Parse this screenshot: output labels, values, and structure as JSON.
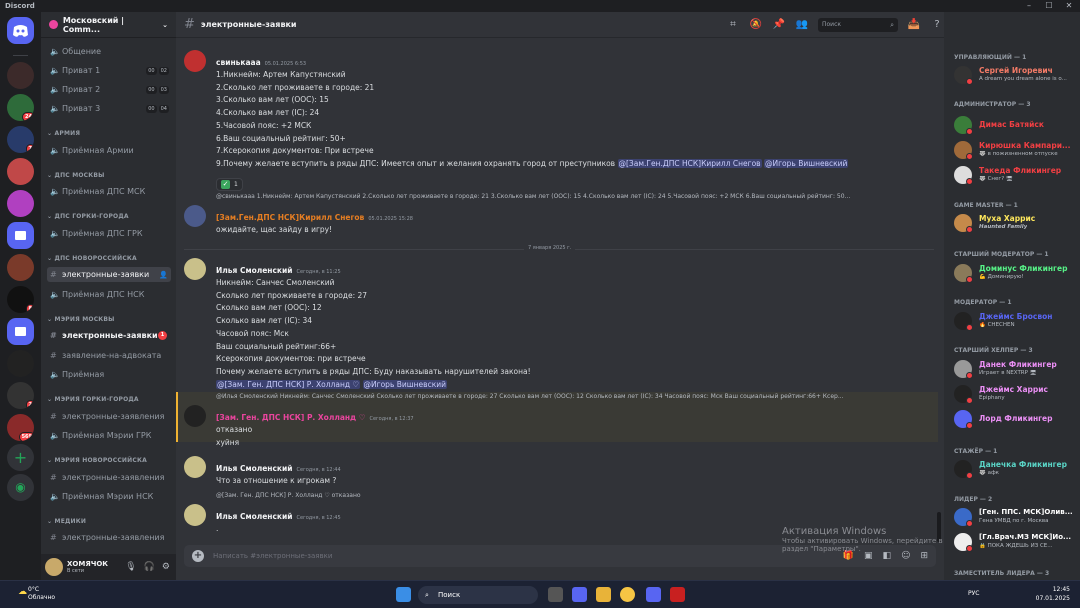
{
  "window": {
    "title": "Discord"
  },
  "servers": [
    {
      "badge": ""
    },
    {
      "badge": "24"
    },
    {
      "badge": "7"
    },
    {
      "badge": ""
    },
    {
      "badge": ""
    },
    {
      "badge": ""
    },
    {
      "badge": ""
    },
    {
      "badge": "8"
    },
    {
      "badge": ""
    },
    {
      "badge": "2"
    },
    {
      "badge": "569"
    }
  ],
  "sidebar": {
    "server_name": "Московский | Comm...",
    "top_channels": [
      {
        "name": "Общение"
      },
      {
        "name": "Приват 1",
        "c1": "00",
        "c2": "02"
      },
      {
        "name": "Приват 2",
        "c1": "00",
        "c2": "03"
      },
      {
        "name": "Приват 3",
        "c1": "00",
        "c2": "04"
      }
    ],
    "categories": [
      {
        "label": "АРМИЯ",
        "channels": [
          "Приёмная Армии"
        ]
      },
      {
        "label": "ДПС МОСКВЫ",
        "channels": [
          "Приёмная ДПС МСК"
        ]
      },
      {
        "label": "ДПС ГОРКИ-ГОРОДА",
        "channels": [
          "Приёмная ДПС ГРК"
        ]
      },
      {
        "label": "ДПС НОВОРОССИЙСКА",
        "channels": [
          "электронные-заявки",
          "Приёмная ДПС НСК"
        ]
      },
      {
        "label": "МЭРИЯ МОСКВЫ",
        "channels": [
          "электронные-заявки",
          "заявление-на-адвоката",
          "Приёмная"
        ]
      },
      {
        "label": "МЭРИЯ ГОРКИ-ГОРОДА",
        "channels": [
          "электронные-заявления",
          "Приёмная Мэрии ГРК"
        ]
      },
      {
        "label": "МЭРИЯ НОВОРОССИЙСКА",
        "channels": [
          "электронные-заявления",
          "Приёмная Мэрии НСК"
        ]
      },
      {
        "label": "МЕДИКИ",
        "channels": [
          "электронные-заявления"
        ]
      }
    ],
    "mention_badge": "1",
    "user": {
      "name": "ХОМЯЧОК",
      "status": "В сети"
    }
  },
  "header": {
    "channel": "электронные-заявки",
    "search_placeholder": "Поиск"
  },
  "messages": {
    "m1": {
      "author": "свинькааа",
      "time": "05.01.2025 6:53",
      "lines": [
        "1.Никнейм: Артем Капустянский",
        "2.Сколько лет проживаете в городе: 21",
        "3.Сколько вам лет (ООС): 15",
        "4.Сколько вам лет (IC): 24",
        "5.Часовой пояс: +2 МСК",
        "6.Ваш социальный рейтинг: 50+",
        "7.Ксерокопия документов: При встрече"
      ],
      "last_line": "9.Почему желаете вступить в ряды ДПС: Имеется опыт и желания охранять город от преступников",
      "mention1": "@[Зам.Ген.ДПС НСК]Кирилл Снегов",
      "mention2": "@Игорь Вишневский",
      "reaction_count": "1"
    },
    "m2": {
      "reply_author": "@свинькааа",
      "reply_text": "1.Никнейм: Артем Капустянский 2.Сколько лет проживаете в городе: 21 3.Сколько вам лет (ООС): 15 4.Сколько вам лет (IC): 24 5.Часовой пояс: +2 МСК 6.Ваш социальный рейтинг: 50...",
      "author": "[Зам.Ген.ДПС НСК]Кирилл Снегов",
      "time": "05.01.2025 15:28",
      "text": "ожидайте, щас зайду в игру!"
    },
    "date_divider": "7 января 2025 г.",
    "m3": {
      "author": "Илья Смоленский",
      "time": "Сегодня, в 11:25",
      "lines": [
        "Никнейм: Санчес Смоленский",
        "Сколько лет проживаете в городе: 27",
        "Сколько вам лет (ООС): 12",
        "Сколько вам лет (IC): 34",
        "Часовой пояс: Мск",
        "Ваш социальный рейтинг:66+",
        "Ксерокопия документов: при встрече",
        "Почему желаете вступить в ряды ДПС: Буду наказывать нарушителей закона!"
      ],
      "mention1": "@[Зам. Ген. ДПС НСК] Р. Холланд ♡",
      "mention2": "@Игорь Вишневский"
    },
    "m4": {
      "reply_author": "@Илья Смоленский",
      "reply_text": "Никнейм: Санчес Смоленский Сколько лет проживаете в городе: 27 Сколько вам лет (ООС): 12 Сколько вам лет (IC): 34 Часовой пояс: Мск Ваш социальный рейтинг:66+ Ксер...",
      "author": "[Зам. Ген. ДПС НСК] Р. Холланд ♡",
      "time": "Сегодня, в 12:37",
      "text": "отказано",
      "text2": "хуйня"
    },
    "m5": {
      "author": "Илья Смоленский",
      "time": "Сегодня, в 12:44",
      "text": "Что за отношение к игрокам ?"
    },
    "m6": {
      "reply_author": "@[Зам. Ген. ДПС НСК] Р. Холланд ♡",
      "reply_text": "отказано",
      "author": "Илья Смоленский",
      "time": "Сегодня, в 12:45",
      "text": "."
    }
  },
  "composer": {
    "placeholder": "Написать #электронные-заявки"
  },
  "watermark": {
    "line1": "Активация Windows",
    "line2": "Чтобы активировать Windows, перейдите в раздел \"Параметры\"."
  },
  "members": {
    "groups": [
      {
        "label": "УПРАВЛЯЮЩИЙ — 1",
        "items": [
          {
            "name": "Сергей Игоревич",
            "sub": "A dream you dream alone is o...",
            "color": "#f47b67"
          }
        ]
      },
      {
        "label": "АДМИНИСТРАТОР — 3",
        "items": [
          {
            "name": "Димас Батяйск",
            "sub": "",
            "color": "#f23f43"
          },
          {
            "name": "Кирюшка Кампари...",
            "sub": "🐺 в пожизненном отпуске",
            "color": "#f23f43"
          },
          {
            "name": "Такеда Фликингер",
            "sub": "🐺 Снег? 🖥",
            "color": "#f23f43"
          }
        ]
      },
      {
        "label": "GAME MASTER — 1",
        "items": [
          {
            "name": "Муха Харрис",
            "sub": "Haunted Family",
            "color": "#fee75c"
          }
        ]
      },
      {
        "label": "СТАРШИЙ МОДЕРАТОР — 1",
        "items": [
          {
            "name": "Доминус Фликингер",
            "sub": "💪 Доминирую!",
            "color": "#57f287"
          }
        ]
      },
      {
        "label": "МОДЕРАТОР — 1",
        "items": [
          {
            "name": "Джеймс Бросвон",
            "sub": "🔥 CHECHEN",
            "color": "#5865f2"
          }
        ]
      },
      {
        "label": "СТАРШИЙ ХЕЛПЕР — 3",
        "items": [
          {
            "name": "Данек Фликингер",
            "sub": "Играет в NEXTRP 🖥",
            "color": "#eb8ff5"
          },
          {
            "name": "Джеймс Харрис",
            "sub": "Epiphany",
            "color": "#eb8ff5"
          },
          {
            "name": "Лорд Фликингер",
            "sub": "",
            "color": "#eb8ff5"
          }
        ]
      },
      {
        "label": "СТАЖЁР — 1",
        "items": [
          {
            "name": "Данечка Фликингер",
            "sub": "🐺 афк",
            "color": "#5ad5c7"
          }
        ]
      },
      {
        "label": "ЛИДЕР — 2",
        "items": [
          {
            "name": "[Ген. ППС. МСК]Олив...",
            "sub": "Гена УМВД по г. Москва",
            "color": "#ffffff"
          },
          {
            "name": "[Гл.Врач.МЗ МСК]Ио...",
            "sub": "🔒 ПОКА ЖДЕШЬ ИЗ СЕ...",
            "color": "#ffffff"
          }
        ]
      },
      {
        "label": "ЗАМЕСТИТЕЛЬ ЛИДЕРА — 3",
        "items": []
      }
    ]
  },
  "taskbar": {
    "temp": "0°C",
    "weather": "Облачно",
    "search": "Поиск",
    "lang": "РУС",
    "time": "12:45",
    "date": "07.01.2025"
  }
}
